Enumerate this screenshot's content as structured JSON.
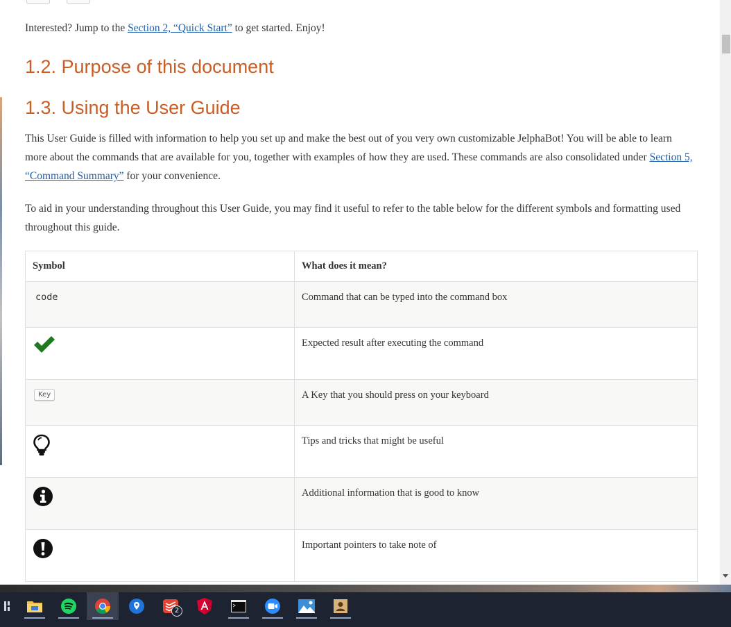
{
  "intro": {
    "prefix": "Interested? Jump to the ",
    "link": "Section 2, “Quick Start”",
    "suffix": " to get started. Enjoy!"
  },
  "sections": [
    {
      "heading": "1.2. Purpose of this document"
    },
    {
      "heading": "1.3. Using the User Guide"
    }
  ],
  "using_guide": {
    "para1_part1": "This User Guide is filled with information to help you set up and make the best out of you very own customizable JelphaBot! You will be able to learn more about the commands that are available for you, together with examples of how they are used. These commands are also consolidated under ",
    "para1_link": "Section 5, “Command Summary”",
    "para1_part2": " for your convenience.",
    "para2": "To aid in your understanding throughout this User Guide, you may find it useful to refer to the table below for the different symbols and formatting used throughout this guide."
  },
  "symbol_table": {
    "headers": [
      "Symbol",
      "What does it mean?"
    ],
    "rows": [
      {
        "symbol_text": "code",
        "symbol_icon": "code-text",
        "meaning": "Command that can be typed into the command box"
      },
      {
        "symbol_text": "",
        "symbol_icon": "checkmark-icon",
        "meaning": "Expected result after executing the command"
      },
      {
        "symbol_text": "Key",
        "symbol_icon": "key-badge",
        "meaning": "A Key that you should press on your keyboard"
      },
      {
        "symbol_text": "",
        "symbol_icon": "lightbulb-icon",
        "meaning": "Tips and tricks that might be useful"
      },
      {
        "symbol_text": "",
        "symbol_icon": "info-icon",
        "meaning": "Additional information that is good to know"
      },
      {
        "symbol_text": "",
        "symbol_icon": "exclamation-icon",
        "meaning": "Important pointers to take note of"
      }
    ]
  },
  "taskbar": {
    "items": [
      "file-explorer-icon",
      "spotify-icon",
      "chrome-icon",
      "maps-icon",
      "todoist-icon",
      "angular-icon",
      "terminal-icon",
      "zoom-icon",
      "photos-icon",
      "contacts-icon"
    ],
    "todoist_badge": "2"
  },
  "colors": {
    "heading": "#ca5d24",
    "link": "#1f5ea8",
    "check": "#1e7a1e",
    "taskbar": "#1d2330"
  }
}
